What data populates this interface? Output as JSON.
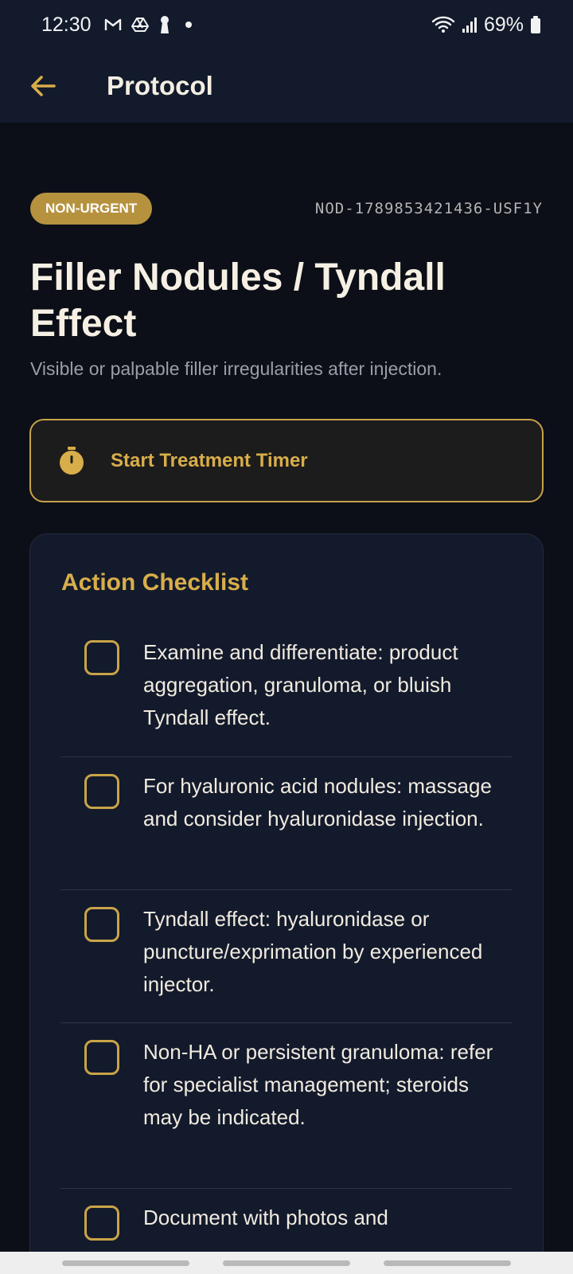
{
  "status_bar": {
    "time": "12:30",
    "battery": "69%",
    "icons_left": [
      "gmail-icon",
      "drive-icon",
      "keyhole-icon",
      "dot-icon"
    ],
    "icons_right": [
      "wifi-icon",
      "signal-icon",
      "battery-icon"
    ]
  },
  "app_bar": {
    "back_icon": "back-arrow-icon",
    "title": "Protocol"
  },
  "protocol": {
    "badge": "NON-URGENT",
    "code": "NOD-1789853421436-USF1Y",
    "title": "Filler Nodules / Tyndall Effect",
    "subtitle": "Visible or palpable filler irregularities after injection."
  },
  "timer": {
    "icon": "stopwatch-icon",
    "label": "Start Treatment Timer"
  },
  "checklist": {
    "title": "Action Checklist",
    "items": [
      {
        "text": "Examine and differentiate: product aggregation, granuloma, or bluish Tyndall effect.",
        "checked": false
      },
      {
        "text": "For hyaluronic acid nodules: massage and consider hyaluronidase injection.",
        "checked": false
      },
      {
        "text": "Tyndall effect: hyaluronidase or puncture/exprimation by experienced injector.",
        "checked": false
      },
      {
        "text": "Non-HA or persistent granuloma: refer for specialist management; steroids may be indicated.",
        "checked": false
      },
      {
        "text": "Document with photos and",
        "checked": false
      }
    ]
  },
  "colors": {
    "background": "#0c0f17",
    "app_bar": "#121a2c",
    "accent_gold": "#d8ae4a",
    "badge": "#b6923f",
    "card": "#131a2c"
  }
}
